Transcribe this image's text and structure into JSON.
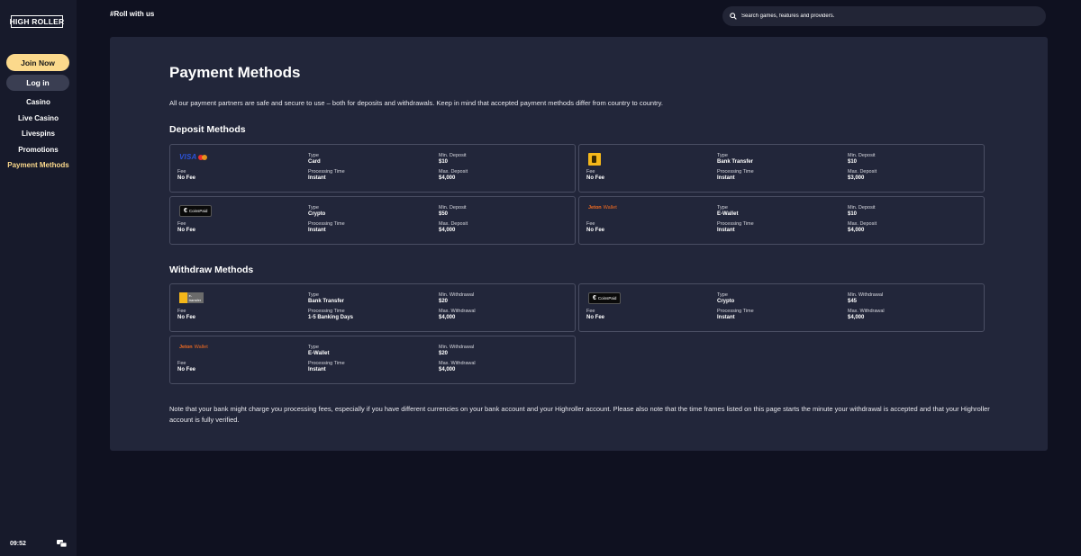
{
  "brand": {
    "logo_text": "HIGH ROLLER"
  },
  "sidebar": {
    "join_label": "Join Now",
    "login_label": "Log in",
    "items": [
      {
        "label": "Casino"
      },
      {
        "label": "Live Casino"
      },
      {
        "label": "Livespins"
      },
      {
        "label": "Promotions"
      },
      {
        "label": "Payment Methods",
        "active": true
      }
    ],
    "time": "09:52"
  },
  "header": {
    "tagline": "#Roll with us",
    "search_placeholder": "Search games, features and providers."
  },
  "main": {
    "title": "Payment Methods",
    "intro": "All our payment partners are safe and secure to use – both for deposits and withdrawals. Keep in mind that accepted payment methods differ from country to country.",
    "deposit_title": "Deposit Methods",
    "withdraw_title": "Withdraw Methods",
    "labels": {
      "type": "Type",
      "fee": "Fee",
      "processing": "Processing Time",
      "min_deposit": "Min. Deposit",
      "max_deposit": "Max. Deposit",
      "min_withdrawal": "Min. Withdrawal",
      "max_withdrawal": "Max. Withdrawal"
    },
    "deposits": [
      {
        "logo": "visa-mastercard",
        "logo_text": "VISA",
        "type": "Card",
        "fee": "No Fee",
        "processing": "Instant",
        "min": "$10",
        "max": "$4,000"
      },
      {
        "logo": "trustly",
        "type": "Bank Transfer",
        "fee": "No Fee",
        "processing": "Instant",
        "min": "$10",
        "max": "$3,000"
      },
      {
        "logo": "coinspaid",
        "logo_text": "CoinsPaid",
        "type": "Crypto",
        "fee": "No Fee",
        "processing": "Instant",
        "min": "$50",
        "max": "$4,000"
      },
      {
        "logo": "jeton",
        "logo_text": "Jeton",
        "logo_sub": "Wallet",
        "type": "E-Wallet",
        "fee": "No Fee",
        "processing": "Instant",
        "min": "$10",
        "max": "$4,000"
      }
    ],
    "withdrawals": [
      {
        "logo": "trustly",
        "type": "Bank Transfer",
        "fee": "No Fee",
        "processing": "1-5 Banking Days",
        "min": "$20",
        "max": "$4,000"
      },
      {
        "logo": "coinspaid",
        "logo_text": "CoinsPaid",
        "type": "Crypto",
        "fee": "No Fee",
        "processing": "Instant",
        "min": "$45",
        "max": "$4,000"
      },
      {
        "logo": "jeton",
        "logo_text": "Jeton",
        "logo_sub": "Wallet",
        "type": "E-Wallet",
        "fee": "No Fee",
        "processing": "Instant",
        "min": "$20",
        "max": "$4,000"
      }
    ],
    "note": "Note that your bank might charge you processing fees, especially if you have different currencies on your bank account and your Highroller account. Please also note that the time frames listed on this page starts the minute your withdrawal is accepted and that your Highroller account is fully verified."
  },
  "colors": {
    "background": "#0f1120",
    "sidebar": "#171a2b",
    "panel": "#22263a",
    "accent": "#fbd98c",
    "card_border": "#4a4e63"
  }
}
